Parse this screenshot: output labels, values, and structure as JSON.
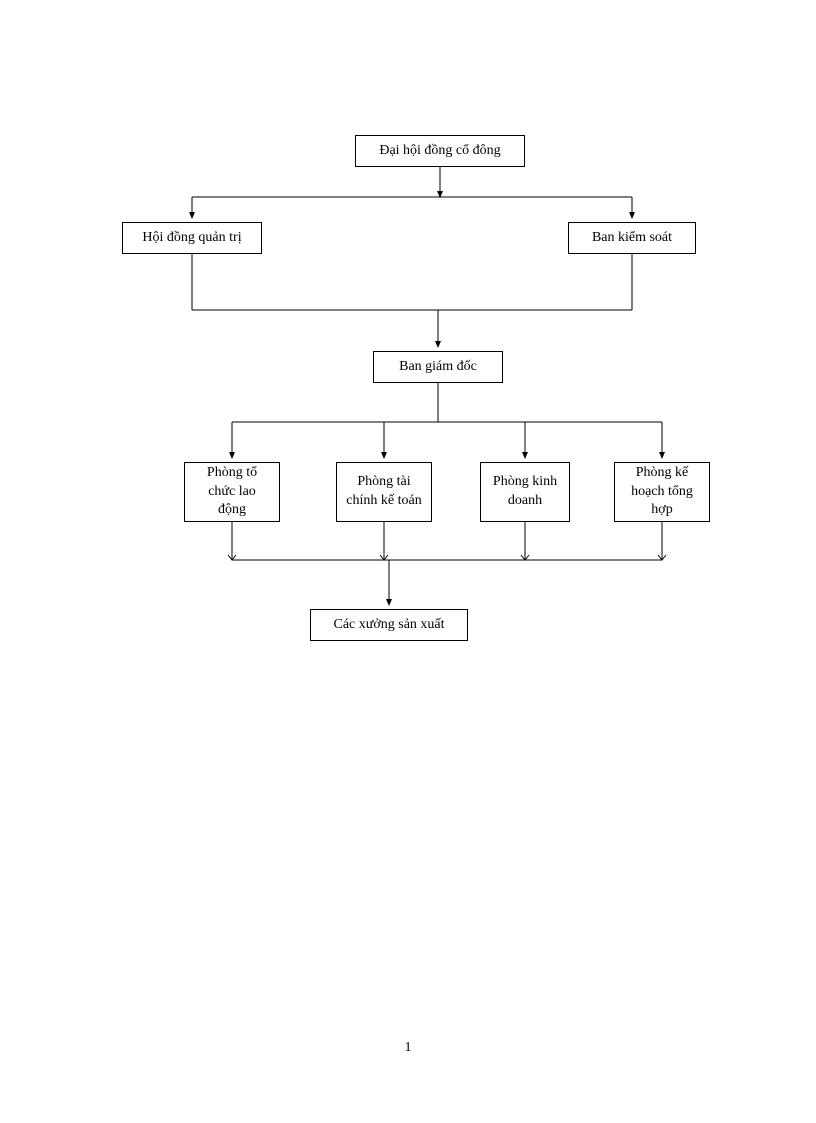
{
  "nodes": {
    "shareholders": "Đại hội đồng cổ đông",
    "board": "Hội đồng quản trị",
    "supervisory": "Ban kiểm soát",
    "directors": "Ban giám đốc",
    "dept_hr": "Phòng tổ chức lao động",
    "dept_finance": "Phòng tài chính kế toán",
    "dept_business": "Phòng kinh doanh",
    "dept_planning": "Phòng kế hoạch tổng hợp",
    "workshops": "Các xưởng sản xuất"
  },
  "page_number": "1"
}
